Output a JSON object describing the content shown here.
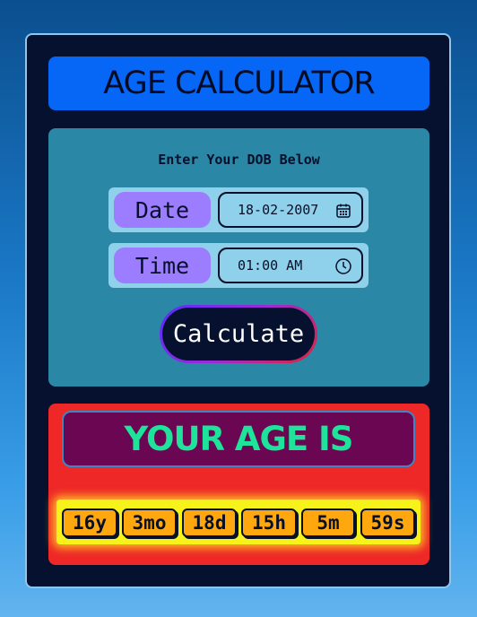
{
  "app": {
    "title": "AGE CALCULATOR"
  },
  "input": {
    "prompt": "Enter Your DOB Below",
    "date_label": "Date",
    "date_value": "18-02-2007",
    "time_label": "Time",
    "time_value": "01:00 AM",
    "calculate_label": "Calculate"
  },
  "result": {
    "heading": "YOUR AGE IS",
    "parts": [
      {
        "label": "16y"
      },
      {
        "label": "3mo"
      },
      {
        "label": "18d"
      },
      {
        "label": "15h"
      },
      {
        "label": "5m"
      },
      {
        "label": "59s"
      }
    ]
  },
  "icons": {
    "date": "calendar-icon",
    "time": "clock-icon"
  },
  "colors": {
    "card": "#05112f",
    "title_bar": "#0666f5",
    "input_panel": "#2b87a6",
    "field_label": "#9c7cff",
    "result_panel": "#ee2727",
    "heading_bg": "#6a0652",
    "heading_text": "#1ee39a",
    "chip": "#ffa70f",
    "chip_strip": "#f6f21a"
  }
}
